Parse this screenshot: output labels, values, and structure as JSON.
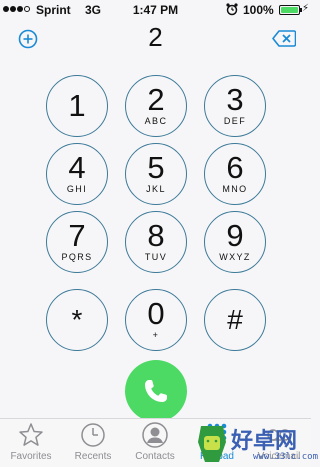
{
  "status_bar": {
    "carrier": "Sprint",
    "network": "3G",
    "time": "1:47 PM",
    "battery": "100%",
    "battery_level": 1.0,
    "signal_bars_filled": 3,
    "signal_bars_total": 4,
    "icons": [
      "alarm-icon",
      "charge-icon"
    ]
  },
  "header": {
    "number": "2",
    "add_icon": "add-contact-icon",
    "delete_icon": "backspace-icon"
  },
  "keys": [
    {
      "digit": "1",
      "letters": ""
    },
    {
      "digit": "2",
      "letters": "ABC"
    },
    {
      "digit": "3",
      "letters": "DEF"
    },
    {
      "digit": "4",
      "letters": "GHI"
    },
    {
      "digit": "5",
      "letters": "JKL"
    },
    {
      "digit": "6",
      "letters": "MNO"
    },
    {
      "digit": "7",
      "letters": "PQRS"
    },
    {
      "digit": "8",
      "letters": "TUV"
    },
    {
      "digit": "9",
      "letters": "WXYZ"
    },
    {
      "digit": "*",
      "letters": ""
    },
    {
      "digit": "0",
      "letters": "+"
    },
    {
      "digit": "#",
      "letters": ""
    }
  ],
  "call_button": {
    "icon": "phone-icon"
  },
  "tabs": [
    {
      "label": "Favorites",
      "icon": "star-icon",
      "active": false
    },
    {
      "label": "Recents",
      "icon": "clock-icon",
      "active": false
    },
    {
      "label": "Contacts",
      "icon": "person-icon",
      "active": false
    },
    {
      "label": "Keypad",
      "icon": "keypad-icon",
      "active": true
    },
    {
      "label": "Voicemail",
      "icon": "voicemail-icon",
      "active": false
    }
  ],
  "watermark": {
    "text": "好卓网",
    "url": "www.33lc.com"
  },
  "colors": {
    "accent": "#1a8ad6",
    "key_ring": "#3d7a98",
    "call_green": "#4cd964",
    "background": "#f6f6f8"
  }
}
